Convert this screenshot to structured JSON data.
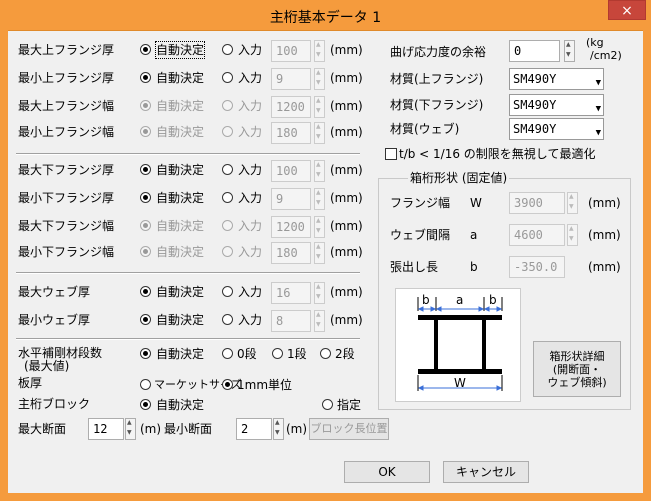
{
  "window": {
    "title": "主桁基本データ 1",
    "close": "×"
  },
  "units": {
    "mm": "(mm)",
    "m": "(m)",
    "kg_cm2_1": "(kg",
    "kg_cm2_2": "/cm2)"
  },
  "radio_labels": {
    "auto": "自動決定",
    "input": "入力"
  },
  "upper_flange": [
    {
      "label": "最大上フランジ厚",
      "value": "100",
      "enabled": true
    },
    {
      "label": "最小上フランジ厚",
      "value": "9",
      "enabled": true
    },
    {
      "label": "最大上フランジ幅",
      "value": "1200",
      "enabled": false
    },
    {
      "label": "最小上フランジ幅",
      "value": "180",
      "enabled": false
    }
  ],
  "lower_flange": [
    {
      "label": "最大下フランジ厚",
      "value": "100",
      "enabled": true
    },
    {
      "label": "最小下フランジ厚",
      "value": "9",
      "enabled": true
    },
    {
      "label": "最大下フランジ幅",
      "value": "1200",
      "enabled": false
    },
    {
      "label": "最小下フランジ幅",
      "value": "180",
      "enabled": false
    }
  ],
  "web": [
    {
      "label": "最大ウェブ厚",
      "value": "16",
      "enabled": true
    },
    {
      "label": "最小ウェブ厚",
      "value": "8",
      "enabled": true
    }
  ],
  "stiffener": {
    "label1": "水平補剛材段数",
    "label2": "(最大値)",
    "auto": "自動決定",
    "opt0": "0段",
    "opt1": "1段",
    "opt2": "2段"
  },
  "plate": {
    "label": "板厚",
    "market": "マーケットサイズ",
    "unit1mm": "1mm単位"
  },
  "block": {
    "label": "主桁ブロック",
    "auto": "自動決定",
    "specify": "指定"
  },
  "section": {
    "max_label": "最大断面",
    "max_value": "12",
    "min_label": "最小断面",
    "min_value": "2",
    "block_pos": "ブロック長位置"
  },
  "stress": {
    "label": "曲げ応力度の余裕",
    "value": "0"
  },
  "materials": [
    {
      "label": "材質(上フランジ)",
      "value": "SM490Y"
    },
    {
      "label": "材質(下フランジ)",
      "value": "SM490Y"
    },
    {
      "label": "材質(ウェブ)",
      "value": "SM490Y"
    }
  ],
  "optimize": {
    "label": "t/b < 1/16 の制限を無視して最適化"
  },
  "box": {
    "title": "箱桁形状 (固定値)",
    "rows": [
      {
        "label": "フランジ幅",
        "sym": "W",
        "value": "3900"
      },
      {
        "label": "ウェブ間隔",
        "sym": "a",
        "value": "4600"
      },
      {
        "label": "張出し長",
        "sym": "b",
        "value": "-350.0"
      }
    ],
    "diagram": {
      "b": "b",
      "a": "a",
      "W": "W"
    },
    "detail_btn": [
      "箱形状詳細",
      "(開断面・",
      "ウェブ傾斜)"
    ]
  },
  "buttons": {
    "ok": "OK",
    "cancel": "キャンセル"
  }
}
